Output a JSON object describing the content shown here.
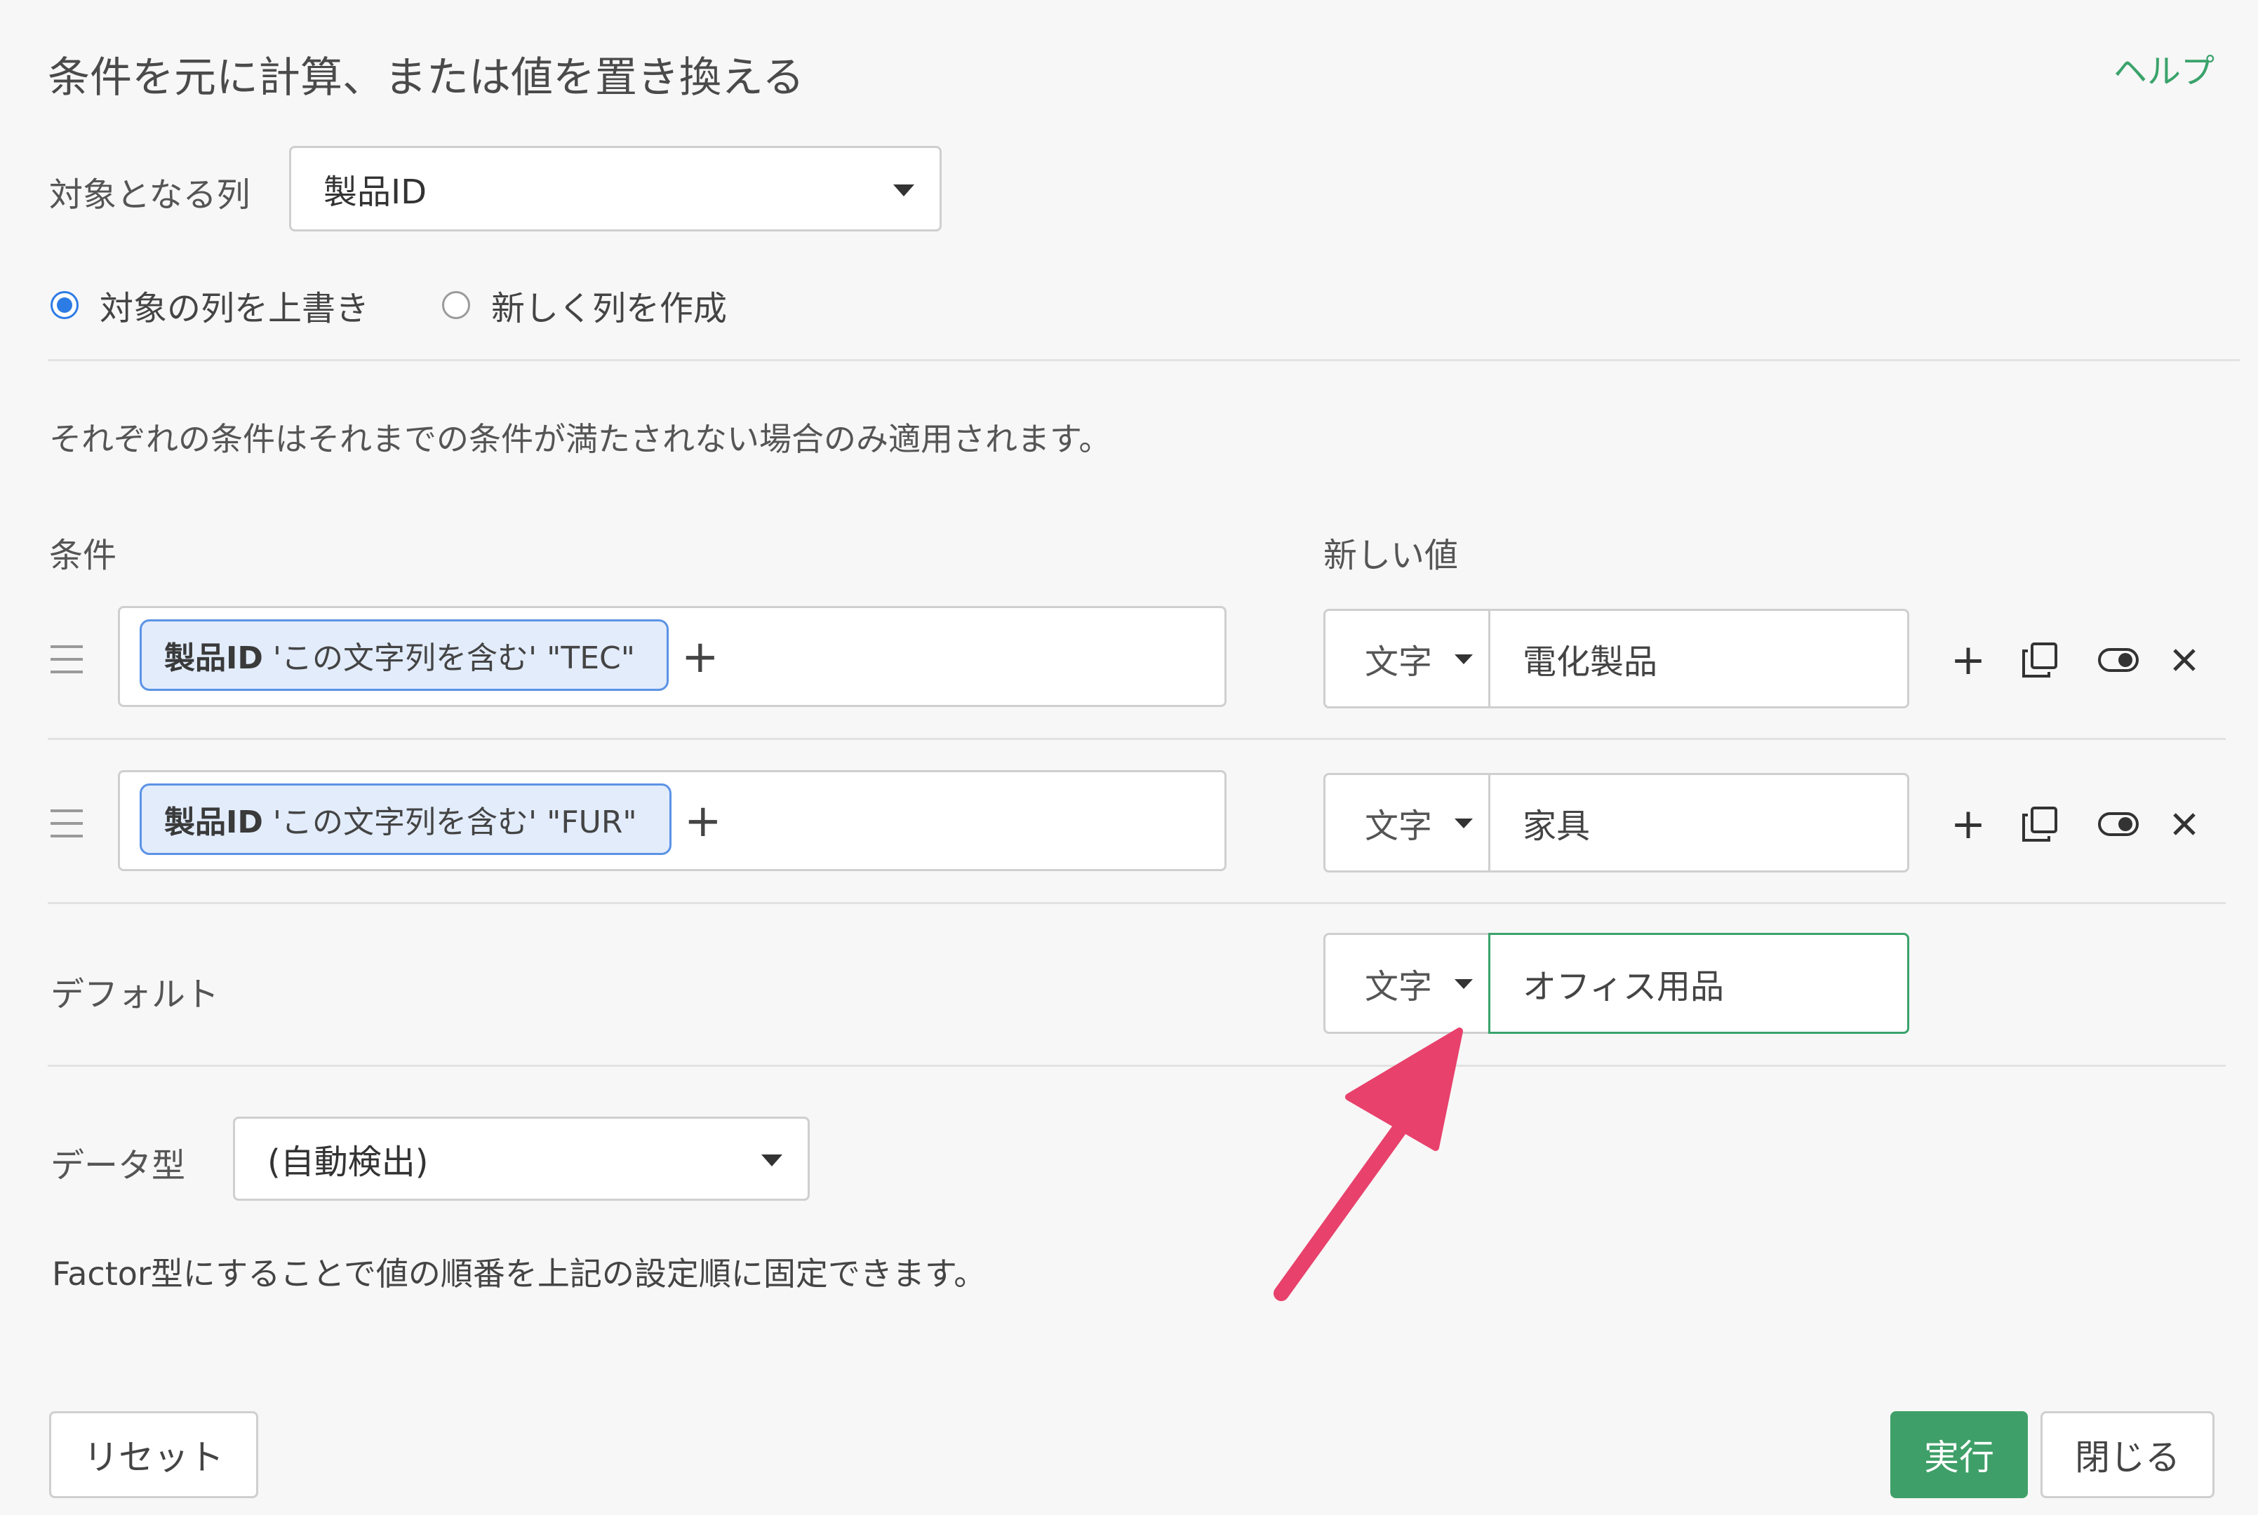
{
  "header": {
    "title": "条件を元に計算、または値を置き換える",
    "help": "ヘルプ"
  },
  "target": {
    "label": "対象となる列",
    "value": "製品ID"
  },
  "mode": {
    "overwrite": "対象の列を上書き",
    "create": "新しく列を作成",
    "selected": "overwrite"
  },
  "info": "それぞれの条件はそれまでの条件が満たされない場合のみ適用されます。",
  "columns": {
    "condition": "条件",
    "new_value": "新しい値"
  },
  "rules": [
    {
      "chip_column": "製品ID",
      "chip_text": "'この文字列を含む' \"TEC\"",
      "type": "文字",
      "value": "電化製品"
    },
    {
      "chip_column": "製品ID",
      "chip_text": "'この文字列を含む' \"FUR\"",
      "type": "文字",
      "value": "家具"
    }
  ],
  "default": {
    "label": "デフォルト",
    "type": "文字",
    "value": "オフィス用品"
  },
  "datatype": {
    "label": "データ型",
    "value": "(自動検出)"
  },
  "factor_note": "Factor型にすることで値の順番を上記の設定順に固定できます。",
  "footer": {
    "reset": "リセット",
    "run": "実行",
    "close": "閉じる"
  },
  "icons": {
    "add": "plus-icon",
    "copy": "copy-icon",
    "toggle": "toggle-icon",
    "remove": "close-icon",
    "annotation": "arrow-annotation"
  },
  "colors": {
    "accent": "#3f9f68",
    "radio": "#2d7be5",
    "chip_border": "#5b93e6",
    "arrow": "#e8416c"
  }
}
